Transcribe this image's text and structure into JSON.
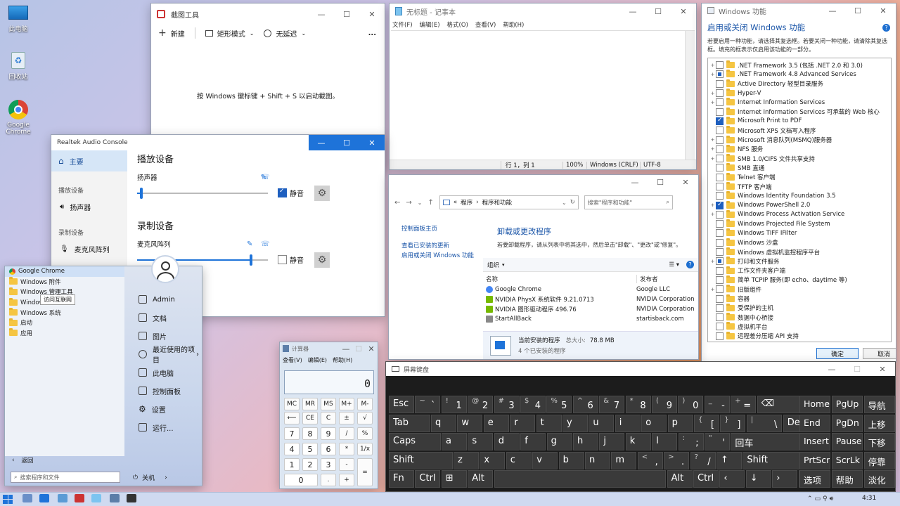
{
  "desktop": {
    "icons": [
      {
        "label": "此电脑"
      },
      {
        "label": "回收站"
      },
      {
        "label": "Google Chrome"
      }
    ]
  },
  "snip": {
    "title": "截图工具",
    "new_label": "新建",
    "mode_label": "矩形模式",
    "delay_label": "无延迟",
    "more": "...",
    "hint": "按 Windows 徽标键 + Shift + S 以启动截图。"
  },
  "notepad": {
    "title": "无标题 - 记事本",
    "menu": [
      "文件(F)",
      "编辑(E)",
      "格式(O)",
      "查看(V)",
      "帮助(H)"
    ],
    "status": {
      "pos": "行 1，列 1",
      "zoom": "100%",
      "eol": "Windows (CRLF)",
      "enc": "UTF-8"
    }
  },
  "features": {
    "title": "Windows 功能",
    "heading": "启用或关闭 Windows 功能",
    "help": "?",
    "desc": "若要启用一种功能，请选择其复选框。若要关闭一种功能，请清除其复选框。填充的框表示仅启用该功能的一部分。",
    "items": [
      {
        "label": ".NET Framework 3.5 (包括 .NET 2.0 和 3.0)",
        "exp": "+",
        "state": "off"
      },
      {
        "label": ".NET Framework 4.8 Advanced Services",
        "exp": "+",
        "state": "part"
      },
      {
        "label": "Active Directory 轻型目录服务",
        "exp": "",
        "state": "off"
      },
      {
        "label": "Hyper-V",
        "exp": "+",
        "state": "off"
      },
      {
        "label": "Internet Information Services",
        "exp": "+",
        "state": "off"
      },
      {
        "label": "Internet Information Services 可承载的 Web 核心",
        "exp": "",
        "state": "off"
      },
      {
        "label": "Microsoft Print to PDF",
        "exp": "",
        "state": "on"
      },
      {
        "label": "Microsoft XPS 文档写入程序",
        "exp": "",
        "state": "off"
      },
      {
        "label": "Microsoft 消息队列(MSMQ)服务器",
        "exp": "+",
        "state": "off"
      },
      {
        "label": "NFS 服务",
        "exp": "+",
        "state": "off"
      },
      {
        "label": "SMB 1.0/CIFS 文件共享支持",
        "exp": "+",
        "state": "off"
      },
      {
        "label": "SMB 直通",
        "exp": "",
        "state": "off"
      },
      {
        "label": "Telnet 客户端",
        "exp": "",
        "state": "off"
      },
      {
        "label": "TFTP 客户端",
        "exp": "",
        "state": "off"
      },
      {
        "label": "Windows Identity Foundation 3.5",
        "exp": "",
        "state": "off"
      },
      {
        "label": "Windows PowerShell 2.0",
        "exp": "+",
        "state": "on"
      },
      {
        "label": "Windows Process Activation Service",
        "exp": "+",
        "state": "off"
      },
      {
        "label": "Windows Projected File System",
        "exp": "",
        "state": "off"
      },
      {
        "label": "Windows TIFF IFilter",
        "exp": "",
        "state": "off"
      },
      {
        "label": "Windows 沙盒",
        "exp": "",
        "state": "off"
      },
      {
        "label": "Windows 虚拟机监控程序平台",
        "exp": "",
        "state": "off"
      },
      {
        "label": "打印和文件服务",
        "exp": "+",
        "state": "part"
      },
      {
        "label": "工作文件夹客户端",
        "exp": "",
        "state": "off"
      },
      {
        "label": "简单 TCPIP 服务(即 echo、daytime 等)",
        "exp": "",
        "state": "off"
      },
      {
        "label": "旧版组件",
        "exp": "+",
        "state": "off"
      },
      {
        "label": "容器",
        "exp": "",
        "state": "off"
      },
      {
        "label": "受保护的主机",
        "exp": "",
        "state": "off"
      },
      {
        "label": "数据中心桥接",
        "exp": "",
        "state": "off"
      },
      {
        "label": "虚拟机平台",
        "exp": "",
        "state": "off"
      },
      {
        "label": "远程差分压缩 API 支持",
        "exp": "",
        "state": "off"
      }
    ],
    "ok": "确定",
    "cancel": "取消"
  },
  "realtek": {
    "title": "Realtek Audio Console",
    "nav_main": "主要",
    "playback_section": "播放设备",
    "speaker": "扬声器",
    "record_section": "录制设备",
    "mic": "麦克风阵列",
    "h_playback": "播放设备",
    "speaker_label": "扬声器",
    "mute": "静音",
    "h_record": "录制设备",
    "mic_label": "麦克风阵列",
    "speaker_level": 0.02,
    "mic_level": 0.87
  },
  "programs": {
    "nav_prefix": "«",
    "path1": "程序",
    "path2": "程序和功能",
    "search_ph": "搜索\"程序和功能\"",
    "left": [
      "控制面板主页",
      "查看已安装的更新",
      "启用或关闭 Windows 功能"
    ],
    "heading": "卸载或更改程序",
    "desc": "若要卸载程序，请从列表中将其选中，然后单击\"卸载\"、\"更改\"或\"修复\"。",
    "organize": "组织",
    "col_name": "名称",
    "col_pub": "发布者",
    "rows": [
      {
        "name": "Google Chrome",
        "pub": "Google LLC"
      },
      {
        "name": "NVIDIA PhysX 系统软件 9.21.0713",
        "pub": "NVIDIA Corporation"
      },
      {
        "name": "NVIDIA 图形驱动程序 496.76",
        "pub": "NVIDIA Corporation"
      },
      {
        "name": "StartAllBack",
        "pub": "startisback.com"
      }
    ],
    "footer_title": "当前安装的程序",
    "total_label": "总大小:",
    "total": "78.8 MB",
    "count": "4 个已安装的程序"
  },
  "calc": {
    "title": "计算器",
    "menu": [
      "查看(V)",
      "编辑(E)",
      "帮助(H)"
    ],
    "display": "0",
    "keys": [
      "MC",
      "MR",
      "MS",
      "M+",
      "M-",
      "⟵",
      "CE",
      "C",
      "±",
      "√",
      "7",
      "8",
      "9",
      "/",
      "%",
      "4",
      "5",
      "6",
      "*",
      "1/x",
      "1",
      "2",
      "3",
      "-",
      "=",
      "0",
      ".",
      "+"
    ]
  },
  "osk": {
    "title": "屏幕键盘"
  },
  "startmenu": {
    "programs": [
      "Google Chrome",
      "Windows 附件",
      "Windows 管理工具",
      "Windows 轻松使用",
      "Windows 系统",
      "启动",
      "应用"
    ],
    "tooltip": "访问互联网",
    "user": "Admin",
    "right": [
      "文档",
      "图片",
      "最近使用的项目",
      "此电脑",
      "控制面板",
      "设置",
      "运行..."
    ],
    "back": "返回",
    "search_ph": "搜索程序和文件",
    "power": "关机"
  },
  "taskbar": {
    "time": "4:31"
  }
}
